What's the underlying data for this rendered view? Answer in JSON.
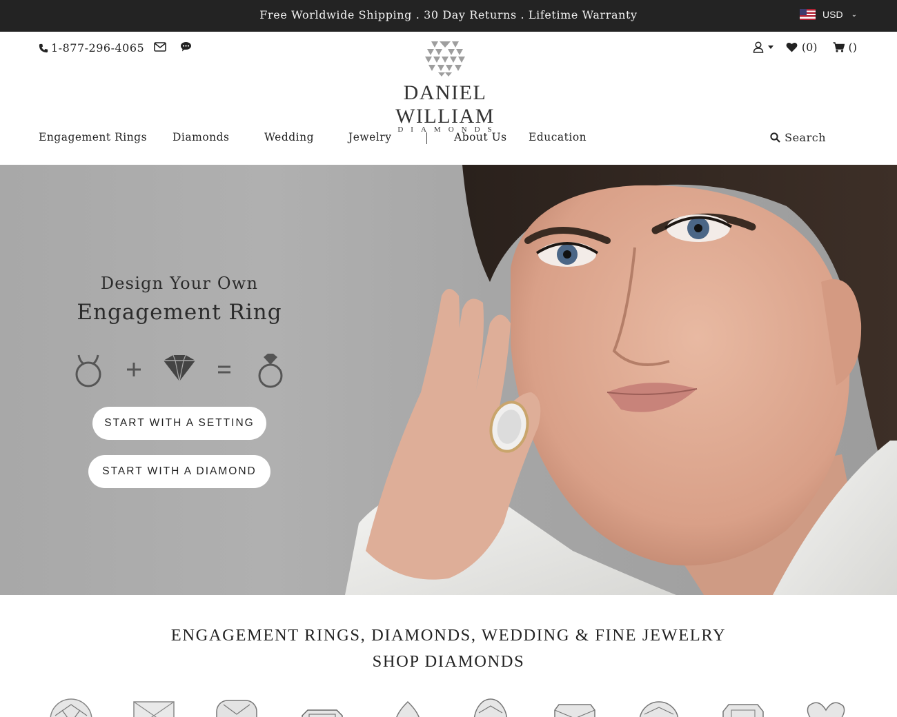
{
  "topbar": {
    "message": "Free Worldwide Shipping . 30 Day Returns . Lifetime Warranty",
    "currency": "USD",
    "flag_icon": "us-flag-icon"
  },
  "header": {
    "phone": "1-877-296-4065",
    "logo_name": "DANIEL WILLIAM",
    "logo_sub": "DIAMONDS",
    "wishlist_count": "(0)",
    "cart_count": "()",
    "icons": [
      "phone-icon",
      "envelope-icon",
      "chat-icon",
      "user-icon",
      "heart-icon",
      "cart-icon"
    ]
  },
  "nav": {
    "items": [
      "Engagement Rings",
      "Diamonds",
      "Wedding",
      "Jewelry",
      "About Us",
      "Education"
    ],
    "search_label": "Search"
  },
  "hero": {
    "line1": "Design Your Own",
    "line2": "Engagement Ring",
    "btn_setting": "START WITH A SETTING",
    "btn_diamond": "START WITH A DIAMOND",
    "equation_icons": [
      "ring-setting-icon",
      "plus-icon",
      "diamond-icon",
      "equals-icon",
      "engagement-ring-icon"
    ]
  },
  "content": {
    "headline1": "ENGAGEMENT RINGS, DIAMONDS, WEDDING & FINE JEWELRY",
    "headline2": "SHOP DIAMONDS",
    "diamond_shapes": [
      "round",
      "princess",
      "cushion",
      "emerald",
      "pear",
      "oval",
      "radiant",
      "asscher",
      "marquise",
      "heart"
    ]
  },
  "colors": {
    "topbar_bg": "#232323",
    "accent": "#ffffff",
    "text": "#222222"
  }
}
